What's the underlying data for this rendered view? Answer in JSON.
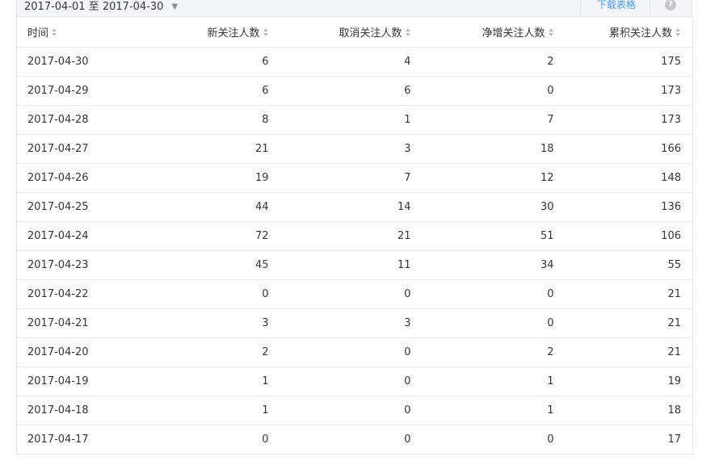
{
  "toolbar": {
    "date_range": "2017-04-01 至 2017-04-30",
    "download_label": "下载表格",
    "help_label": "?"
  },
  "table": {
    "headers": [
      "时间",
      "新关注人数",
      "取消关注人数",
      "净增关注人数",
      "累积关注人数"
    ],
    "rows": [
      [
        "2017-04-30",
        "6",
        "4",
        "2",
        "175"
      ],
      [
        "2017-04-29",
        "6",
        "6",
        "0",
        "173"
      ],
      [
        "2017-04-28",
        "8",
        "1",
        "7",
        "173"
      ],
      [
        "2017-04-27",
        "21",
        "3",
        "18",
        "166"
      ],
      [
        "2017-04-26",
        "19",
        "7",
        "12",
        "148"
      ],
      [
        "2017-04-25",
        "44",
        "14",
        "30",
        "136"
      ],
      [
        "2017-04-24",
        "72",
        "21",
        "51",
        "106"
      ],
      [
        "2017-04-23",
        "45",
        "11",
        "34",
        "55"
      ],
      [
        "2017-04-22",
        "0",
        "0",
        "0",
        "21"
      ],
      [
        "2017-04-21",
        "3",
        "3",
        "0",
        "21"
      ],
      [
        "2017-04-20",
        "2",
        "0",
        "2",
        "21"
      ],
      [
        "2017-04-19",
        "1",
        "0",
        "1",
        "19"
      ],
      [
        "2017-04-18",
        "1",
        "0",
        "1",
        "18"
      ],
      [
        "2017-04-17",
        "0",
        "0",
        "0",
        "17"
      ]
    ]
  },
  "icons": {
    "sort": "sort-icon",
    "caret": "caret-down-icon",
    "help": "help-icon"
  }
}
